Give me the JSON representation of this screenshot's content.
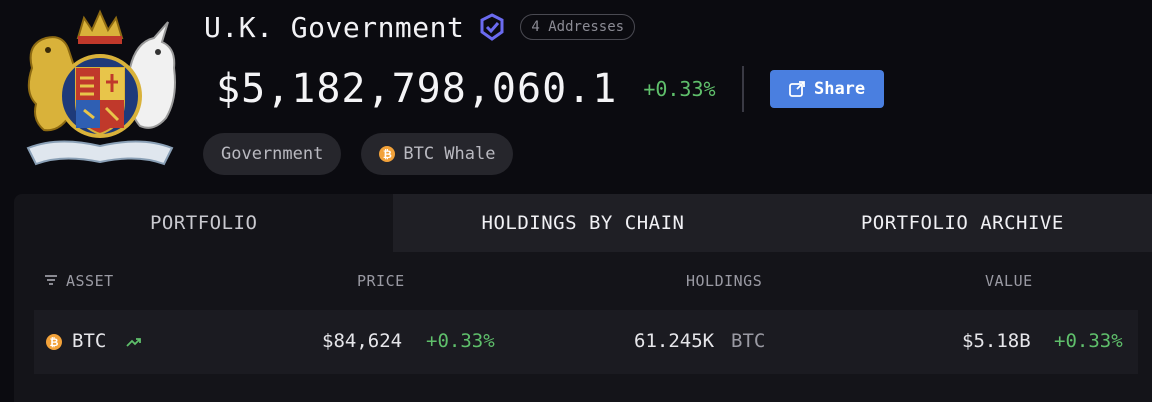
{
  "entity": {
    "name": "U.K. Government",
    "addresses_badge": "4 Addresses",
    "total_value": "$5,182,798,060.1",
    "total_change": "+0.33%",
    "share_label": "Share",
    "tags": [
      {
        "label": "Government"
      },
      {
        "label": "BTC Whale",
        "icon": "btc-icon"
      }
    ]
  },
  "tabs": [
    {
      "label": "PORTFOLIO",
      "active": true
    },
    {
      "label": "HOLDINGS BY CHAIN",
      "active": false
    },
    {
      "label": "PORTFOLIO ARCHIVE",
      "active": false
    }
  ],
  "table": {
    "headers": {
      "asset": "ASSET",
      "price": "PRICE",
      "holdings": "HOLDINGS",
      "value": "VALUE"
    },
    "rows": [
      {
        "asset": "BTC",
        "icon": "btc-icon",
        "price": "$84,624",
        "price_change": "+0.33%",
        "holdings": "61.245K",
        "holdings_unit": "BTC",
        "value": "$5.18B",
        "value_change": "+0.33%"
      }
    ]
  },
  "colors": {
    "background": "#0b0b10",
    "accent_blue": "#4a7fe0",
    "positive_green": "#5fbf6b",
    "btc_orange": "#f2a23a"
  }
}
